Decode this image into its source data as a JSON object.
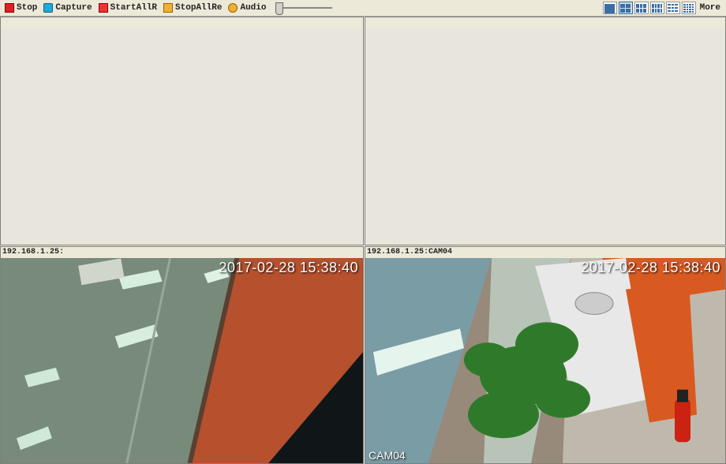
{
  "toolbar": {
    "stop": "Stop",
    "capture": "Capture",
    "startAllR": "StartAllR",
    "stopAllRe": "StopAllRe",
    "audio": "Audio",
    "more": "More"
  },
  "panes": {
    "top_left": {
      "header": ""
    },
    "top_right": {
      "header": ""
    },
    "bottom_left": {
      "header": "192.168.1.25:",
      "timestamp": "2017-02-28 15:38:40"
    },
    "bottom_right": {
      "header": "192.168.1.25:CAM04",
      "timestamp": "2017-02-28 15:38:40",
      "camlabel": "CAM04"
    }
  }
}
